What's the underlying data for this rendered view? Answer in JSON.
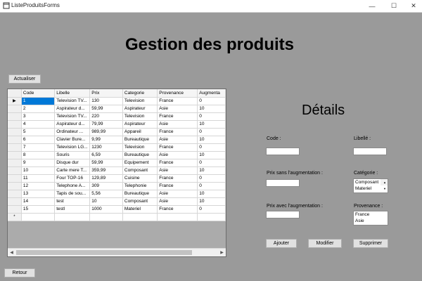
{
  "window": {
    "title": "ListeProduitsForms",
    "app_icon": "form-icon"
  },
  "heading": "Gestion des produits",
  "toolbar": {
    "refresh_label": "Actualiser"
  },
  "grid": {
    "columns": [
      "Code",
      "Libelle",
      "Prix",
      "Categorie",
      "Provenance",
      "Augmenta"
    ],
    "rows": [
      [
        "1",
        "Television TV...",
        "130",
        "Television",
        "France",
        "0"
      ],
      [
        "2",
        "Aspirateur d...",
        "59,99",
        "Aspirateur",
        "Asie",
        "10"
      ],
      [
        "3",
        "Television TV...",
        "220",
        "Television",
        "France",
        "0"
      ],
      [
        "4",
        "Aspirateur d...",
        "79,99",
        "Aspirateur",
        "Asie",
        "10"
      ],
      [
        "5",
        "Ordinateur ...",
        "989,99",
        "Appareil",
        "France",
        "0"
      ],
      [
        "6",
        "Clavier Bure...",
        "9,99",
        "Bureautique",
        "Asie",
        "10"
      ],
      [
        "7",
        "Television LG...",
        "1230",
        "Television",
        "France",
        "0"
      ],
      [
        "8",
        "Souris",
        "6,59",
        "Bureautique",
        "Asie",
        "10"
      ],
      [
        "9",
        "Disque dur",
        "59,99",
        "Equipement",
        "France",
        "0"
      ],
      [
        "10",
        "Carte mere T...",
        "359,99",
        "Composant",
        "Asie",
        "10"
      ],
      [
        "11",
        "Four TOP-16",
        "129,89",
        "Cuisine",
        "France",
        "0"
      ],
      [
        "12",
        "Telephone A...",
        "309",
        "Telephonie",
        "France",
        "0"
      ],
      [
        "13",
        "Tapis de sou...",
        "5,56",
        "Bureautique",
        "Asie",
        "10"
      ],
      [
        "14",
        "test",
        "10",
        "Composant",
        "Asie",
        "10"
      ],
      [
        "15",
        "testl",
        "1000",
        "Materiel",
        "France",
        "0"
      ]
    ],
    "current_row_marker": "▶",
    "new_row_marker": "*"
  },
  "details": {
    "title": "Détails",
    "code_label": "Code :",
    "libelle_label": "Libellé :",
    "prix_sans_label": "Prix sans l'augmentation :",
    "prix_avec_label": "Prix avec l'augmentation :",
    "categorie_label": "Catégorie :",
    "categorie_options": [
      "Composant",
      "Materiel"
    ],
    "provenance_label": "Provenance :",
    "provenance_options": [
      "France",
      "Asie"
    ]
  },
  "actions": {
    "add_label": "Ajouter",
    "modify_label": "Modifier",
    "delete_label": "Supprimer"
  },
  "footer": {
    "back_label": "Retour"
  }
}
